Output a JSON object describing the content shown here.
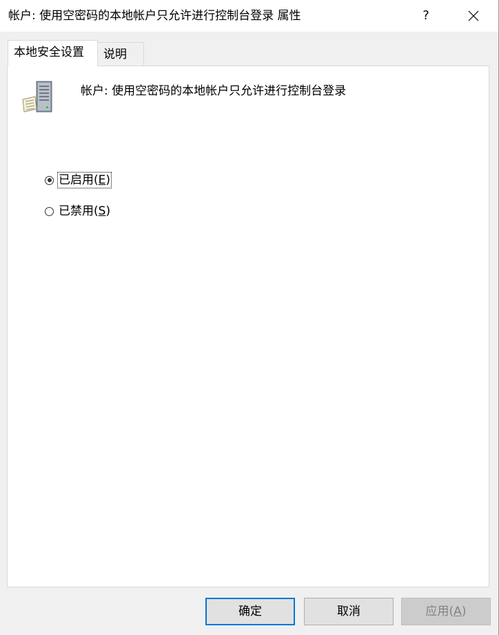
{
  "window": {
    "title": "帐户: 使用空密码的本地帐户只允许进行控制台登录 属性",
    "help_label": "?",
    "close_icon": "close-icon"
  },
  "tabs": [
    {
      "label": "本地安全设置",
      "active": true
    },
    {
      "label": "说明",
      "active": false
    }
  ],
  "policy": {
    "icon": "server-policy-icon",
    "name": "帐户: 使用空密码的本地帐户只允许进行控制台登录"
  },
  "options": {
    "enabled": {
      "label": "已启用(",
      "mnemonic": "E",
      "suffix": ")",
      "checked": true
    },
    "disabled": {
      "label": "已禁用(",
      "mnemonic": "S",
      "suffix": ")",
      "checked": false
    }
  },
  "buttons": {
    "ok": "确定",
    "cancel": "取消",
    "apply": {
      "label": "应用(",
      "mnemonic": "A",
      "suffix": ")",
      "disabled": true
    }
  },
  "colors": {
    "accent": "#0078d7",
    "disabled_text": "#838383"
  }
}
